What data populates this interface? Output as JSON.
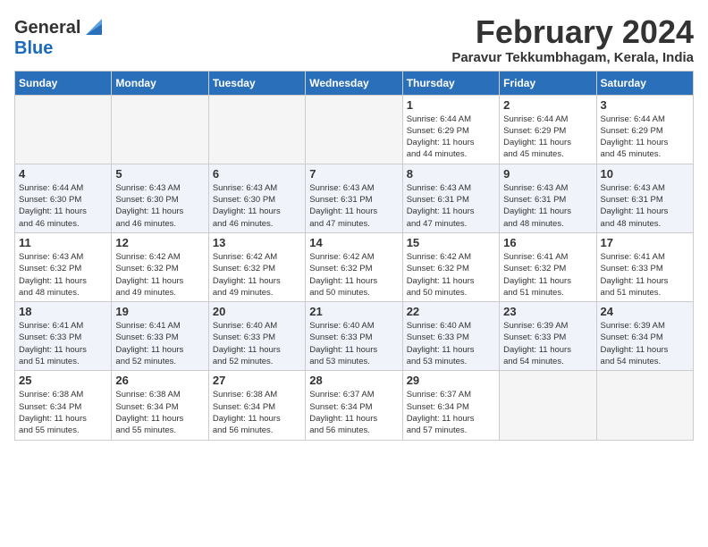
{
  "logo": {
    "general": "General",
    "blue": "Blue"
  },
  "title": "February 2024",
  "subtitle": "Paravur Tekkumbhagam, Kerala, India",
  "days_of_week": [
    "Sunday",
    "Monday",
    "Tuesday",
    "Wednesday",
    "Thursday",
    "Friday",
    "Saturday"
  ],
  "weeks": [
    [
      {
        "day": "",
        "info": ""
      },
      {
        "day": "",
        "info": ""
      },
      {
        "day": "",
        "info": ""
      },
      {
        "day": "",
        "info": ""
      },
      {
        "day": "1",
        "info": "Sunrise: 6:44 AM\nSunset: 6:29 PM\nDaylight: 11 hours\nand 44 minutes."
      },
      {
        "day": "2",
        "info": "Sunrise: 6:44 AM\nSunset: 6:29 PM\nDaylight: 11 hours\nand 45 minutes."
      },
      {
        "day": "3",
        "info": "Sunrise: 6:44 AM\nSunset: 6:29 PM\nDaylight: 11 hours\nand 45 minutes."
      }
    ],
    [
      {
        "day": "4",
        "info": "Sunrise: 6:44 AM\nSunset: 6:30 PM\nDaylight: 11 hours\nand 46 minutes."
      },
      {
        "day": "5",
        "info": "Sunrise: 6:43 AM\nSunset: 6:30 PM\nDaylight: 11 hours\nand 46 minutes."
      },
      {
        "day": "6",
        "info": "Sunrise: 6:43 AM\nSunset: 6:30 PM\nDaylight: 11 hours\nand 46 minutes."
      },
      {
        "day": "7",
        "info": "Sunrise: 6:43 AM\nSunset: 6:31 PM\nDaylight: 11 hours\nand 47 minutes."
      },
      {
        "day": "8",
        "info": "Sunrise: 6:43 AM\nSunset: 6:31 PM\nDaylight: 11 hours\nand 47 minutes."
      },
      {
        "day": "9",
        "info": "Sunrise: 6:43 AM\nSunset: 6:31 PM\nDaylight: 11 hours\nand 48 minutes."
      },
      {
        "day": "10",
        "info": "Sunrise: 6:43 AM\nSunset: 6:31 PM\nDaylight: 11 hours\nand 48 minutes."
      }
    ],
    [
      {
        "day": "11",
        "info": "Sunrise: 6:43 AM\nSunset: 6:32 PM\nDaylight: 11 hours\nand 48 minutes."
      },
      {
        "day": "12",
        "info": "Sunrise: 6:42 AM\nSunset: 6:32 PM\nDaylight: 11 hours\nand 49 minutes."
      },
      {
        "day": "13",
        "info": "Sunrise: 6:42 AM\nSunset: 6:32 PM\nDaylight: 11 hours\nand 49 minutes."
      },
      {
        "day": "14",
        "info": "Sunrise: 6:42 AM\nSunset: 6:32 PM\nDaylight: 11 hours\nand 50 minutes."
      },
      {
        "day": "15",
        "info": "Sunrise: 6:42 AM\nSunset: 6:32 PM\nDaylight: 11 hours\nand 50 minutes."
      },
      {
        "day": "16",
        "info": "Sunrise: 6:41 AM\nSunset: 6:32 PM\nDaylight: 11 hours\nand 51 minutes."
      },
      {
        "day": "17",
        "info": "Sunrise: 6:41 AM\nSunset: 6:33 PM\nDaylight: 11 hours\nand 51 minutes."
      }
    ],
    [
      {
        "day": "18",
        "info": "Sunrise: 6:41 AM\nSunset: 6:33 PM\nDaylight: 11 hours\nand 51 minutes."
      },
      {
        "day": "19",
        "info": "Sunrise: 6:41 AM\nSunset: 6:33 PM\nDaylight: 11 hours\nand 52 minutes."
      },
      {
        "day": "20",
        "info": "Sunrise: 6:40 AM\nSunset: 6:33 PM\nDaylight: 11 hours\nand 52 minutes."
      },
      {
        "day": "21",
        "info": "Sunrise: 6:40 AM\nSunset: 6:33 PM\nDaylight: 11 hours\nand 53 minutes."
      },
      {
        "day": "22",
        "info": "Sunrise: 6:40 AM\nSunset: 6:33 PM\nDaylight: 11 hours\nand 53 minutes."
      },
      {
        "day": "23",
        "info": "Sunrise: 6:39 AM\nSunset: 6:33 PM\nDaylight: 11 hours\nand 54 minutes."
      },
      {
        "day": "24",
        "info": "Sunrise: 6:39 AM\nSunset: 6:34 PM\nDaylight: 11 hours\nand 54 minutes."
      }
    ],
    [
      {
        "day": "25",
        "info": "Sunrise: 6:38 AM\nSunset: 6:34 PM\nDaylight: 11 hours\nand 55 minutes."
      },
      {
        "day": "26",
        "info": "Sunrise: 6:38 AM\nSunset: 6:34 PM\nDaylight: 11 hours\nand 55 minutes."
      },
      {
        "day": "27",
        "info": "Sunrise: 6:38 AM\nSunset: 6:34 PM\nDaylight: 11 hours\nand 56 minutes."
      },
      {
        "day": "28",
        "info": "Sunrise: 6:37 AM\nSunset: 6:34 PM\nDaylight: 11 hours\nand 56 minutes."
      },
      {
        "day": "29",
        "info": "Sunrise: 6:37 AM\nSunset: 6:34 PM\nDaylight: 11 hours\nand 57 minutes."
      },
      {
        "day": "",
        "info": ""
      },
      {
        "day": "",
        "info": ""
      }
    ]
  ]
}
